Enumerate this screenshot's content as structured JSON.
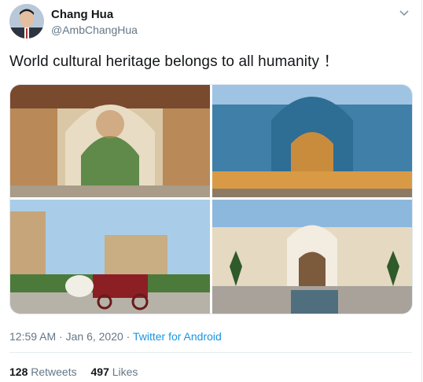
{
  "author": {
    "name": "Chang Hua",
    "handle": "@AmbChangHua"
  },
  "tweet": {
    "text": "World cultural heritage belongs to all humanity ！"
  },
  "media": {
    "photo_count": 4
  },
  "meta": {
    "time": "12:59 AM",
    "separator": "·",
    "date": "Jan 6, 2020",
    "source": "Twitter for Android"
  },
  "stats": {
    "retweets_count": "128",
    "retweets_label": "Retweets",
    "likes_count": "497",
    "likes_label": "Likes"
  },
  "colors": {
    "link": "#1b95e0",
    "secondary_text": "#657786",
    "primary_text": "#14171a"
  }
}
